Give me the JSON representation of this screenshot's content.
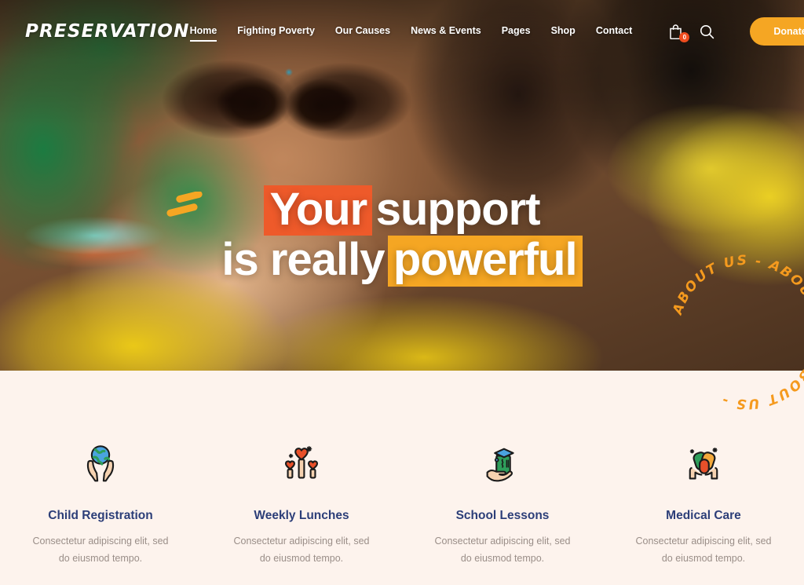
{
  "brand": {
    "logo": "PRESERVATION"
  },
  "colors": {
    "accent_orange": "#F5A623",
    "accent_red": "#EE5A2A",
    "badge_red": "#EE4C1E",
    "title_navy": "#2C3E78",
    "body_gray": "#9a8e88",
    "section_cream": "#FDF3ED"
  },
  "nav": {
    "items": [
      {
        "label": "Home",
        "active": true
      },
      {
        "label": "Fighting Poverty",
        "active": false
      },
      {
        "label": "Our Causes",
        "active": false
      },
      {
        "label": "News & Events",
        "active": false
      },
      {
        "label": "Pages",
        "active": false
      },
      {
        "label": "Shop",
        "active": false
      },
      {
        "label": "Contact",
        "active": false
      }
    ]
  },
  "tools": {
    "cart_icon": "shopping-bag-icon",
    "cart_count": "0",
    "search_icon": "search-icon",
    "donate_label": "Donate"
  },
  "hero": {
    "line1_part1": "Your",
    "line1_part2": "support",
    "line2_part1": "is really",
    "line2_part2": "powerful",
    "accent_icon": "dash-accent-icon",
    "about_badge_text": "ABOUT US  -  ABOUT US  -  ABOUT US  -  "
  },
  "features": [
    {
      "icon": "globe-in-hands-icon",
      "title": "Child Registration",
      "desc": "Consectetur adipiscing elit, sed do eiusmod tempo."
    },
    {
      "icon": "hearts-in-hands-icon",
      "title": "Weekly Lunches",
      "desc": "Consectetur adipiscing elit, sed do eiusmod tempo."
    },
    {
      "icon": "graduation-book-in-hand-icon",
      "title": "School Lessons",
      "desc": "Consectetur adipiscing elit, sed do eiusmod tempo."
    },
    {
      "icon": "pills-in-hands-icon",
      "title": "Medical Care",
      "desc": "Consectetur adipiscing elit, sed do eiusmod tempo."
    }
  ]
}
